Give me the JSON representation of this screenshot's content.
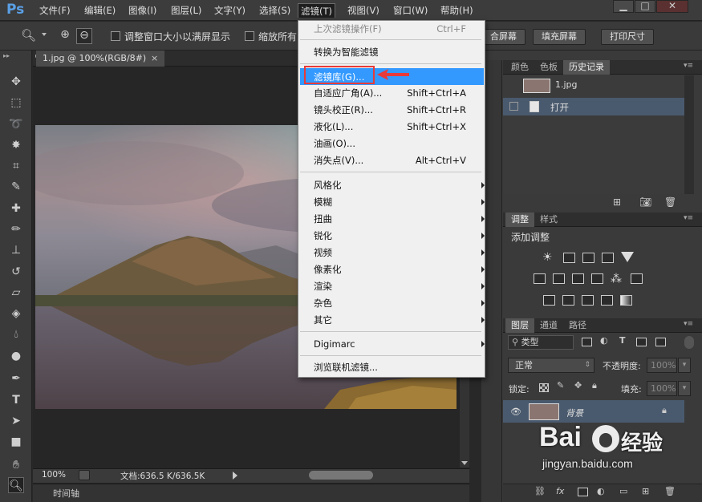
{
  "app": {
    "logo": "Ps"
  },
  "menubar": [
    "文件(F)",
    "编辑(E)",
    "图像(I)",
    "图层(L)",
    "文字(Y)",
    "选择(S)",
    "滤镜(T)",
    "视图(V)",
    "窗口(W)",
    "帮助(H)"
  ],
  "window_buttons": [
    "▁",
    "□",
    "✕"
  ],
  "options": {
    "resize_windows": "调整窗口大小以满屏显示",
    "zoom_all": "缩放所有",
    "fill_screen_partial": "合屏幕",
    "fill_screen": "填充屏幕",
    "print_size": "打印尺寸"
  },
  "document": {
    "tab": "1.jpg @ 100%(RGB/8#)",
    "tab_close": "×",
    "zoom": "100%",
    "doc_info": "文档:636.5 K/636.5K",
    "timeline": "时间轴"
  },
  "filter_menu": {
    "last_filter": {
      "label": "上次滤镜操作(F)",
      "shortcut": "Ctrl+F"
    },
    "smart": "转换为智能滤镜",
    "gallery": "滤镜库(G)...",
    "group1": [
      {
        "label": "自适应广角(A)...",
        "shortcut": "Shift+Ctrl+A"
      },
      {
        "label": "镜头校正(R)...",
        "shortcut": "Shift+Ctrl+R"
      },
      {
        "label": "液化(L)...",
        "shortcut": "Shift+Ctrl+X"
      },
      {
        "label": "油画(O)...",
        "shortcut": ""
      },
      {
        "label": "消失点(V)...",
        "shortcut": "Alt+Ctrl+V"
      }
    ],
    "submenus": [
      "风格化",
      "模糊",
      "扭曲",
      "锐化",
      "视频",
      "像素化",
      "渲染",
      "杂色",
      "其它"
    ],
    "digimarc": "Digimarc",
    "browse": "浏览联机滤镜..."
  },
  "history_panel": {
    "tabs": [
      "颜色",
      "色板",
      "历史记录"
    ],
    "snapshot": "1.jpg",
    "step": "打开"
  },
  "adjust_panel": {
    "tabs": [
      "调整",
      "样式"
    ],
    "title": "添加调整"
  },
  "layers_panel": {
    "tabs": [
      "图层",
      "通道",
      "路径"
    ],
    "filter_kind": "类型",
    "blend_mode": "正常",
    "opacity_label": "不透明度:",
    "opacity_value": "100%",
    "lock_label": "锁定:",
    "fill_label": "填充:",
    "fill_value": "100%",
    "layer_name": "背景"
  },
  "watermark": {
    "brand": "Bai",
    "brand_sub": "经验",
    "site": "jingyan.baidu.com"
  },
  "colors": {
    "highlight": "#3399ff",
    "red_box": "#e83a3a"
  }
}
